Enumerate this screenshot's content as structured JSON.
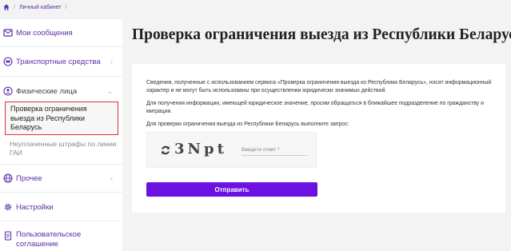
{
  "breadcrumb": {
    "home_icon": "home-icon",
    "separator": "/",
    "items": [
      "Личный кабинет"
    ]
  },
  "sidebar": {
    "items": [
      {
        "label": "Мои сообщения",
        "icon": "message-icon"
      },
      {
        "label": "Транспортные средства",
        "icon": "car-icon"
      },
      {
        "label": "Физические лица",
        "icon": "person-icon"
      },
      {
        "label": "Прочее",
        "icon": "globe-icon"
      },
      {
        "label": "Настройки",
        "icon": "gear-icon"
      },
      {
        "label": "Пользовательское соглашение",
        "icon": "document-icon"
      }
    ],
    "sub_items": [
      {
        "label": "Проверка ограничения выезда из Республики Беларусь",
        "active": true
      },
      {
        "label": "Неуплаченные штрафы по линии ГАИ",
        "active": false
      }
    ]
  },
  "main": {
    "title": "Проверка ограничения выезда из Республики Беларусь",
    "paragraph1": "Сведения, полученные с использованием сервиса «Проверка ограничения выезда из Республики Беларусь», носят информационный характер и не могут быть использованы при осуществлении юридически значимых действий.",
    "paragraph2": "Для получения информации, имеющей юридическое значение, просим обращаться в ближайшее подразделение по гражданству и миграции.",
    "paragraph3": "Для проверки ограничения выезда из Республики Беларусь выполните запрос:",
    "captcha_text": "3Nрt",
    "captcha_placeholder": "Введите ответ *",
    "submit_label": "Отправить"
  },
  "colors": {
    "accent": "#6d11e2",
    "link": "#5a2ea6",
    "active_border": "#e0303a"
  }
}
